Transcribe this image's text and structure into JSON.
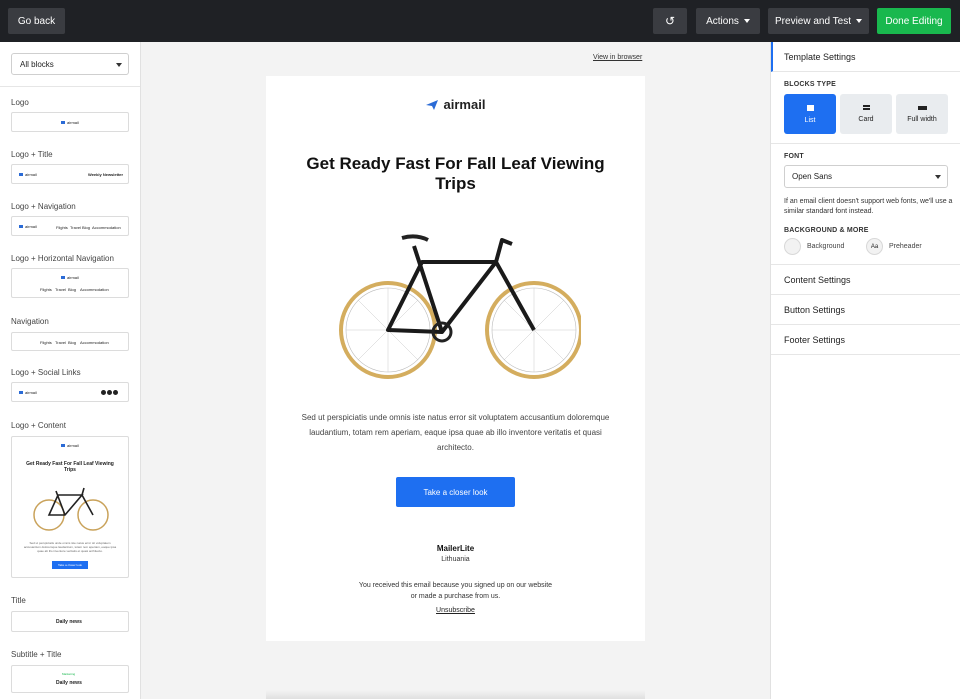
{
  "topbar": {
    "back_label": "Go back",
    "undo_icon": "↺",
    "actions_label": "Actions",
    "preview_label": "Preview and Test",
    "done_label": "Done Editing",
    "done_color": "#19b84e"
  },
  "left": {
    "filter_value": "All blocks",
    "blocks": [
      {
        "label": "Logo"
      },
      {
        "label": "Logo + Title"
      },
      {
        "label": "Logo + Navigation"
      },
      {
        "label": "Logo + Horizontal Navigation"
      },
      {
        "label": "Navigation"
      },
      {
        "label": "Logo + Social Links"
      },
      {
        "label": "Logo + Content"
      },
      {
        "label": "Title"
      },
      {
        "label": "Subtitle + Title"
      }
    ],
    "previews": {
      "logo_text": "airmail",
      "newsletter_title": "Weekly Newsletter",
      "nav_items": [
        "Flights",
        "Travel",
        "Blog",
        "Accommodation"
      ],
      "content_headline": "Get Ready Fast For Fall Leaf Viewing Trips",
      "content_button": "Take a closer look",
      "title_text": "Daily news",
      "subtitle_text": "Marketing"
    }
  },
  "canvas": {
    "view_in_browser": "View in browser",
    "brand": "airmail",
    "headline": "Get Ready Fast For Fall Leaf Viewing Trips",
    "body": "Sed ut perspiciatis unde omnis iste natus error sit voluptatem accusantium doloremque laudantium, totam rem aperiam, eaque ipsa quae ab illo inventore veritatis et quasi architecto.",
    "cta": "Take a closer look",
    "company": "MailerLite",
    "country": "Lithuania",
    "received": "You received this email because you signed up on our website or made a purchase from us.",
    "unsubscribe": "Unsubscribe",
    "accent": "#1e6ff1"
  },
  "right": {
    "template_settings": "Template Settings",
    "blocks_type_head": "BLOCKS TYPE",
    "types": [
      "List",
      "Card",
      "Full width"
    ],
    "font_head": "FONT",
    "font_value": "Open Sans",
    "font_hint": "If an email client doesn't support web fonts, we'll use a similar standard font instead.",
    "bg_head": "BACKGROUND & MORE",
    "background_label": "Background",
    "preheader_label": "Preheader",
    "preheader_icon": "Aa",
    "content_settings": "Content Settings",
    "button_settings": "Button Settings",
    "footer_settings": "Footer Settings"
  }
}
